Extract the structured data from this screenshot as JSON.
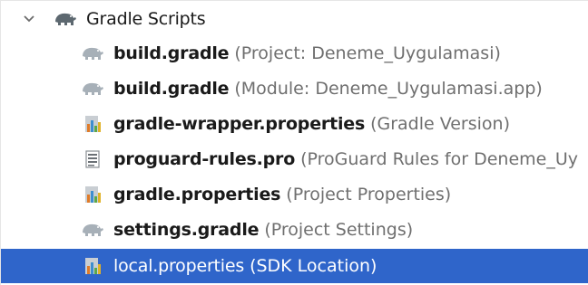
{
  "tree": {
    "root": {
      "label": "Gradle Scripts",
      "icon": "gradle-elephant-icon",
      "expanded": true
    },
    "items": [
      {
        "name": "build.gradle",
        "hint": "(Project: Deneme_Uygulamasi)",
        "icon": "gradle-elephant-icon"
      },
      {
        "name": "build.gradle",
        "hint": "(Module: Deneme_Uygulamasi.app)",
        "icon": "gradle-elephant-icon"
      },
      {
        "name": "gradle-wrapper.properties",
        "hint": "(Gradle Version)",
        "icon": "properties-file-icon"
      },
      {
        "name": "proguard-rules.pro",
        "hint": "(ProGuard Rules for Deneme_Uy",
        "icon": "text-file-icon"
      },
      {
        "name": "gradle.properties",
        "hint": "(Project Properties)",
        "icon": "properties-file-icon"
      },
      {
        "name": "settings.gradle",
        "hint": "(Project Settings)",
        "icon": "gradle-elephant-icon"
      },
      {
        "name": "local.properties",
        "hint": "(SDK Location)",
        "icon": "properties-file-icon",
        "selected": true
      }
    ]
  },
  "colors": {
    "selection": "#2f65ca",
    "hint_text": "#6f6f6f",
    "gradle_icon": "#9aa4ad",
    "gradle_icon_root": "#5d6870"
  }
}
